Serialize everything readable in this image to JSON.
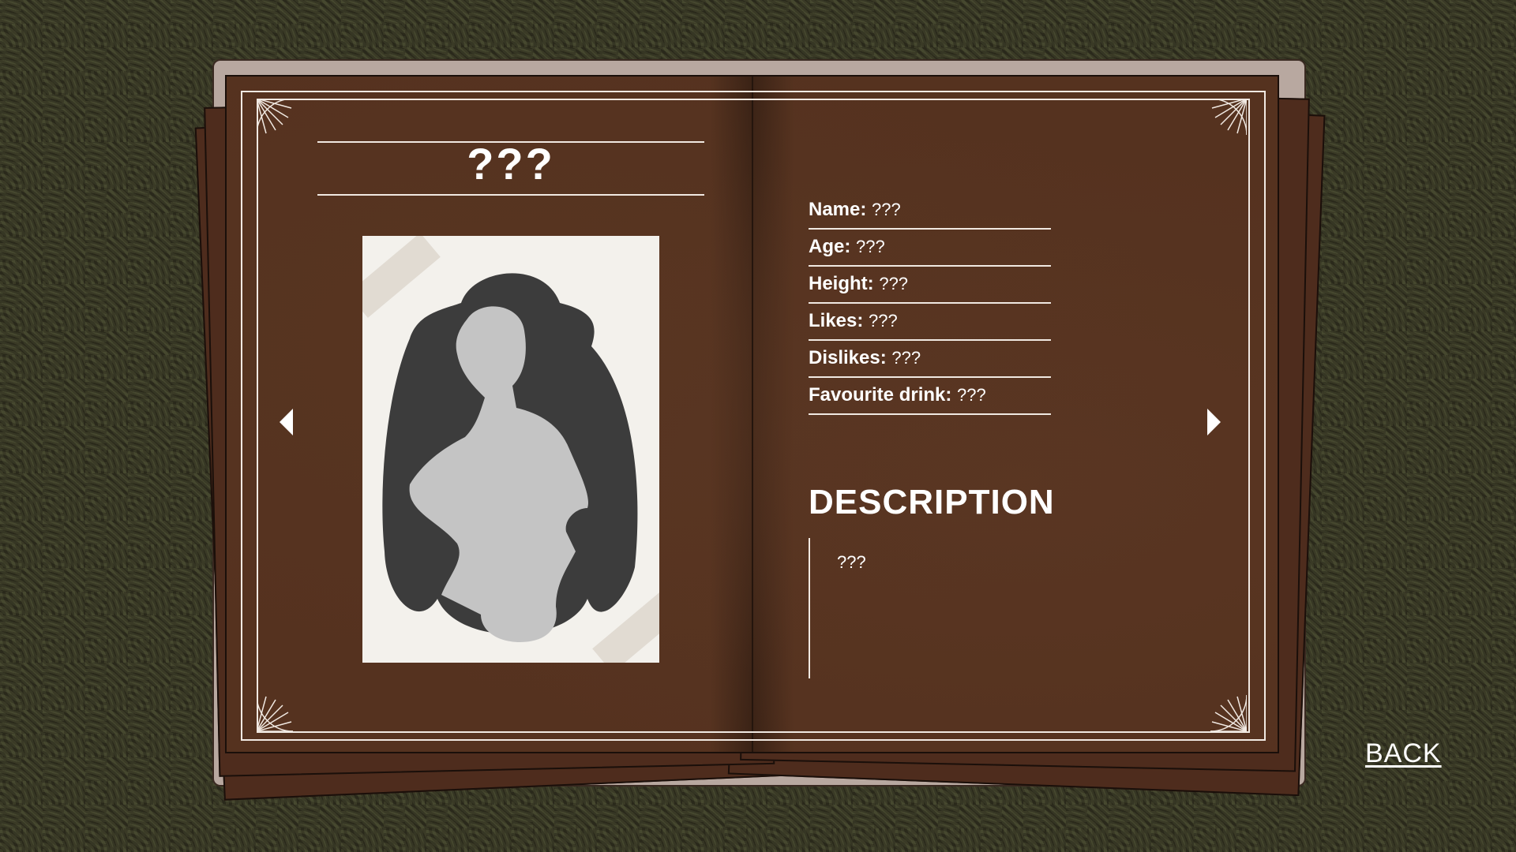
{
  "profile": {
    "title": "???",
    "fields": [
      {
        "label": "Name:",
        "value": "???"
      },
      {
        "label": "Age:",
        "value": "???"
      },
      {
        "label": "Height:",
        "value": "???"
      },
      {
        "label": "Likes:",
        "value": "???"
      },
      {
        "label": "Dislikes:",
        "value": "???"
      },
      {
        "label": "Favourite drink:",
        "value": "???"
      }
    ],
    "description_heading": "DESCRIPTION",
    "description_text": "???",
    "portrait": "locked-character-silhouette"
  },
  "navigation": {
    "prev_icon": "triangle-left-icon",
    "next_icon": "triangle-right-icon",
    "back_label": "BACK"
  },
  "colors": {
    "page": "#55321f",
    "frame": "#f1e9e2",
    "silhouette_back": "#3c3c3c",
    "silhouette_front": "#c4c4c4",
    "background": "#2e2c1d"
  }
}
